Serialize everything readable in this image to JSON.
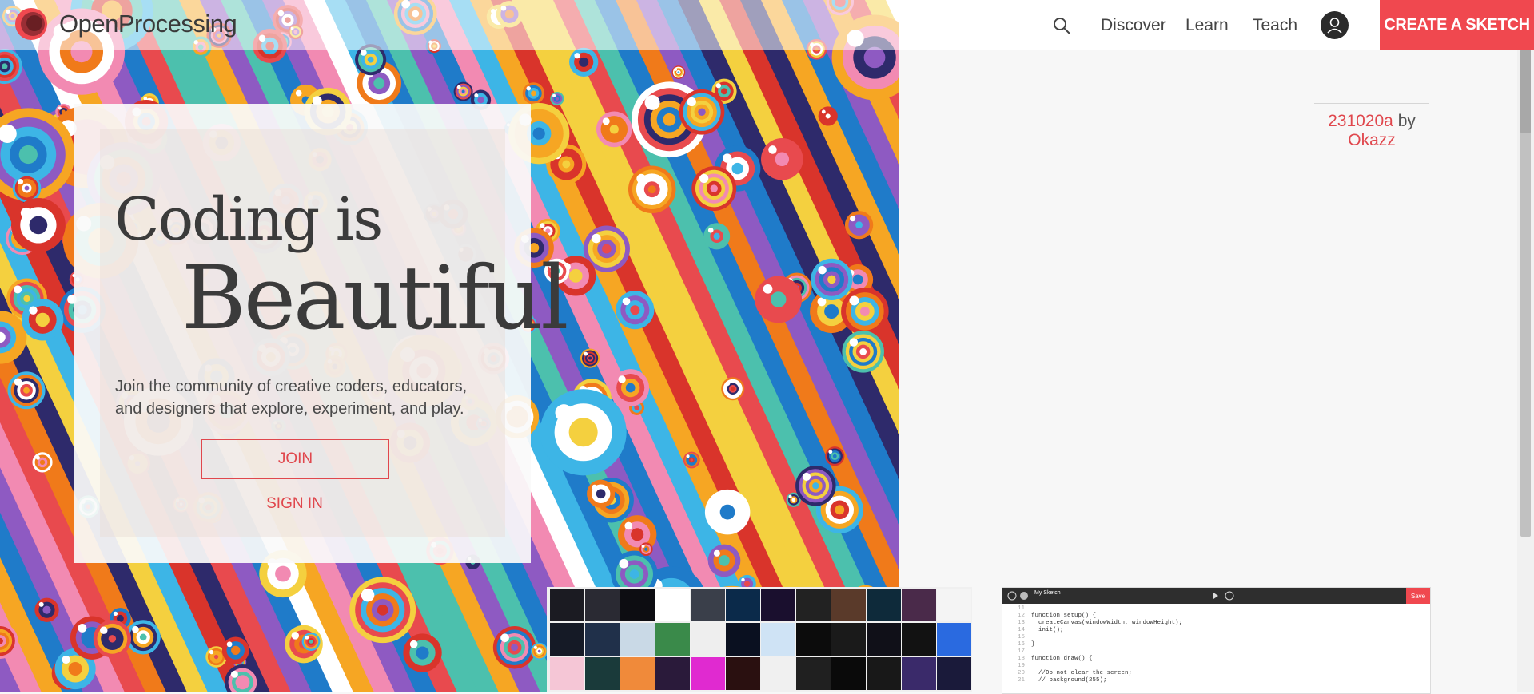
{
  "brand": {
    "name": "OpenProcessing"
  },
  "nav": {
    "search_icon": "search-icon",
    "links": [
      "Discover",
      "Learn",
      "Teach"
    ],
    "create_label": "CREATE A SKETCH",
    "accent": "#f0484f"
  },
  "hero": {
    "title_line1": "Coding is",
    "title_line2": "Beautiful",
    "tagline": "Join the community of creative coders, educators, and designers that explore, experiment, and play.",
    "join_label": "JOIN",
    "signin_label": "SIGN IN"
  },
  "credit": {
    "sketch": "231020a",
    "by": "by",
    "author": "Okazz"
  },
  "editor_preview": {
    "sketch_name": "My Sketch",
    "save_label": "Save",
    "code_lines": [
      {
        "n": "11",
        "t": ""
      },
      {
        "n": "12",
        "t": "function setup() {"
      },
      {
        "n": "13",
        "t": "  createCanvas(windowWidth, windowHeight);"
      },
      {
        "n": "14",
        "t": "  init();"
      },
      {
        "n": "15",
        "t": ""
      },
      {
        "n": "16",
        "t": "}"
      },
      {
        "n": "17",
        "t": ""
      },
      {
        "n": "18",
        "t": "function draw() {"
      },
      {
        "n": "19",
        "t": ""
      },
      {
        "n": "20",
        "t": "  //Do not clear the screen;"
      },
      {
        "n": "21",
        "t": "  // background(255);"
      }
    ]
  }
}
